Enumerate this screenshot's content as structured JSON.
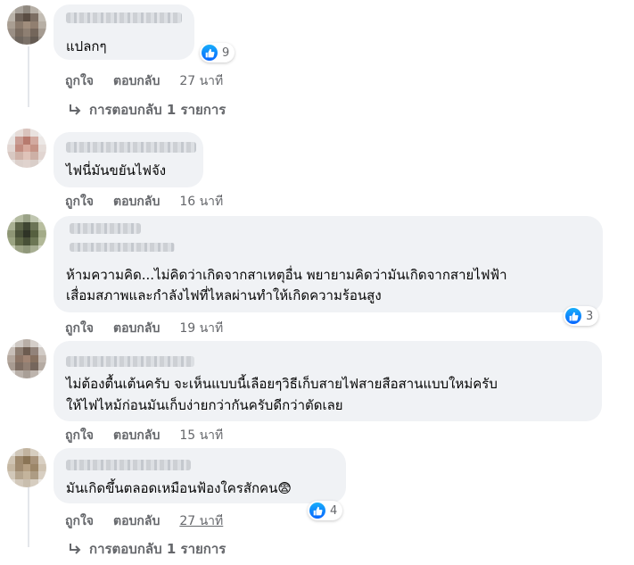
{
  "comments": [
    {
      "text_lines": [
        "แปลกๆ"
      ],
      "reaction_count": "9",
      "like_label": "ถูกใจ",
      "reply_label": "ตอบกลับ",
      "time": "27 นาที",
      "replies_label": "การตอบกลับ 1 รายการ"
    },
    {
      "text_lines": [
        "ไฟนี่มันขยันไฟจัง"
      ],
      "like_label": "ถูกใจ",
      "reply_label": "ตอบกลับ",
      "time": "16 นาที"
    },
    {
      "text_lines": [
        "ห้ามความคิด...ไม่คิดว่าเกิดจากสาเหตุอื่น พยายามคิดว่ามันเกิดจากสายไฟฟ้า",
        "เสื่อมสภาพและกำลังไฟที่ไหลผ่านทำให้เกิดความร้อนสูง"
      ],
      "reaction_count": "3",
      "like_label": "ถูกใจ",
      "reply_label": "ตอบกลับ",
      "time": "19 นาที"
    },
    {
      "text_lines": [
        "ไม่ต้องตื้นเต้นครับ จะเห็นแบบนี้เลือยๆวิธีเก็บสายไฟสายสือสานแบบใหม่ครับ",
        "ให้ไฟไหม้ก่อนมันเก็บง่ายกว่ากันครับดีกว่าตัดเลย"
      ],
      "like_label": "ถูกใจ",
      "reply_label": "ตอบกลับ",
      "time": "15 นาที"
    },
    {
      "text_lines": [
        "มันเกิดขึ้นตลอดเหมือนฟ้องใครสักคน😨"
      ],
      "reaction_count": "4",
      "like_label": "ถูกใจ",
      "reply_label": "ตอบกลับ",
      "time": "27 นาที",
      "replies_label": "การตอบกลับ 1 รายการ"
    }
  ],
  "colors": {
    "bubble": "#f0f2f5",
    "meta": "#65676b",
    "like_blue": "#0866ff"
  },
  "icons": {
    "like": "thumbs-up-icon",
    "reply_arrow": "reply-arrow-icon"
  }
}
